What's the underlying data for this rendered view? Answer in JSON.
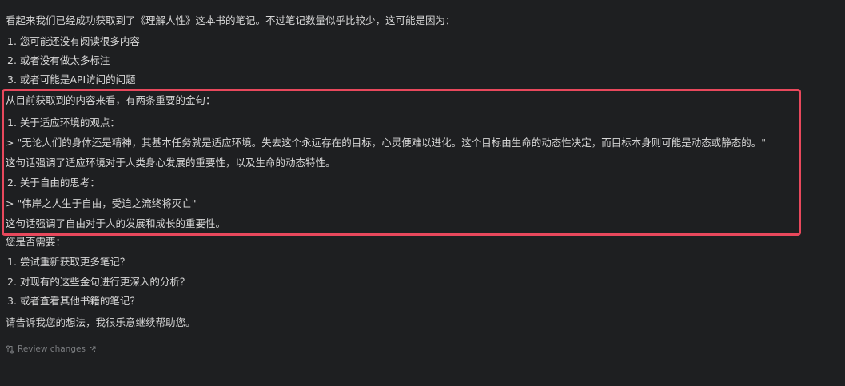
{
  "chat": {
    "intro": "看起来我们已经成功获取到了《理解人性》这本书的笔记。不过笔记数量似乎比较少，这可能是因为：",
    "reasons": [
      "1. 您可能还没有阅读很多内容",
      "2. 或者没有做太多标注",
      "3. 或者可能是API访问的问题"
    ],
    "quotes_intro": "从目前获取到的内容来看，有两条重要的金句：",
    "quote1": {
      "title": "1. 关于适应环境的观点：",
      "text": "> \"无论人们的身体还是精神，其基本任务就是适应环境。失去这个永远存在的目标，心灵便难以进化。这个目标由生命的动态性决定，而目标本身则可能是动态或静态的。\"",
      "comment": "这句话强调了适应环境对于人类身心发展的重要性，以及生命的动态特性。"
    },
    "quote2": {
      "title": "2. 关于自由的思考：",
      "text": "> \"伟岸之人生于自由，受迫之流终将灭亡\"",
      "comment": "这句话强调了自由对于人的发展和成长的重要性。"
    },
    "question": "您是否需要：",
    "options": [
      "1. 尝试重新获取更多笔记？",
      "2. 对现有的这些金句进行更深入的分析？",
      "3. 或者查看其他书籍的笔记？"
    ],
    "closing": "请告诉我您的想法，我很乐意继续帮助您。"
  },
  "footer": {
    "review_label": "Review changes",
    "review_icon": "review-changes-icon",
    "link_icon": "external-link-icon"
  },
  "colors": {
    "background": "#1e1f21",
    "text": "#d7d7d7",
    "muted": "#7b7d80",
    "highlight_border": "#e8485c"
  }
}
